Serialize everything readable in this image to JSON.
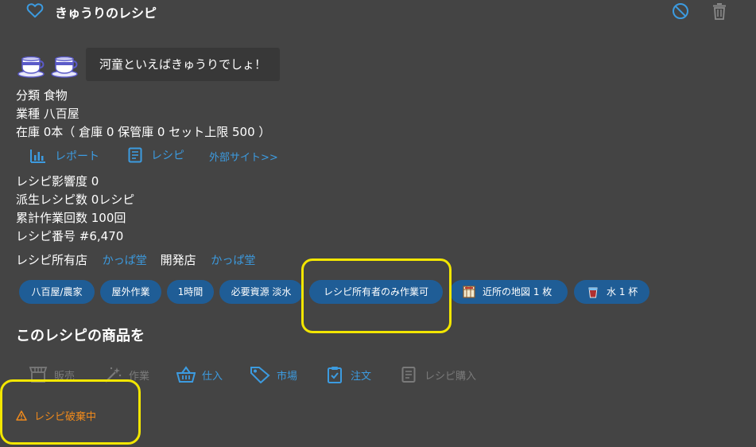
{
  "header": {
    "title": "きゅうりのレシピ"
  },
  "speech": "河童といえばきゅうりでしょ！",
  "info": {
    "category": "分類 食物",
    "business": "業種 八百屋",
    "stock": "在庫 0本（ 倉庫 0  保管庫 0  セット上限 500 ）"
  },
  "links": {
    "report": "レポート",
    "recipe": "レシピ",
    "external": "外部サイト>>"
  },
  "stats": {
    "influence": "レシピ影響度 0",
    "derived": "派生レシピ数 0レシピ",
    "total_work": "累計作業回数 100回",
    "number": "レシピ番号 #6,470"
  },
  "owner": {
    "owner_label": "レシピ所有店",
    "owner_value": "かっぱ堂",
    "dev_label": "開発店",
    "dev_value": "かっぱ堂"
  },
  "tags": [
    "八百屋/農家",
    "屋外作業",
    "1時間",
    "必要資源 淡水",
    "レシピ所有者のみ作業可",
    "近所の地図 1 枚",
    "水 1 杯"
  ],
  "section_title": "このレシピの商品を",
  "actions": {
    "sell": "販売",
    "work": "作業",
    "purchase": "仕入",
    "market": "市場",
    "order": "注文",
    "buy_recipe": "レシピ購入"
  },
  "warning": "レシピ破棄中",
  "colors": {
    "background": "#444444",
    "accent": "#3c9be0",
    "pill": "#1f5d96",
    "warning": "#f08a1c",
    "highlight": "#f2e600",
    "disabled": "#7a7a7a"
  }
}
